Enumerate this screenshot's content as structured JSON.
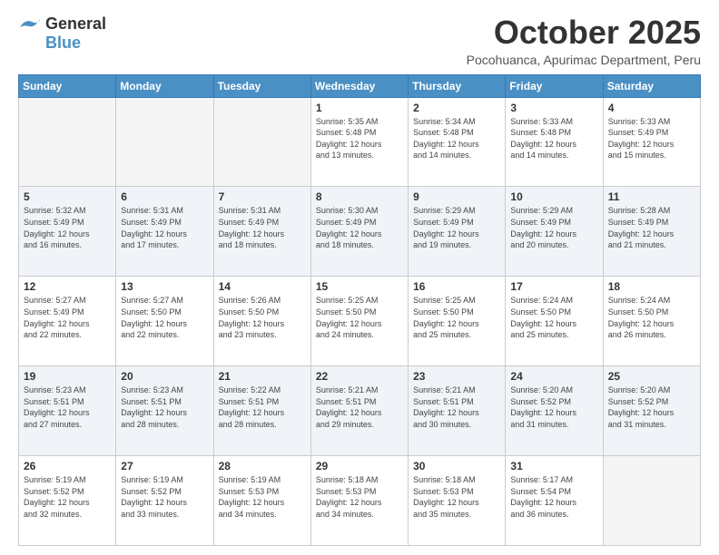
{
  "logo": {
    "line1": "General",
    "line2": "Blue"
  },
  "title": "October 2025",
  "subtitle": "Pocohuanca, Apurimac Department, Peru",
  "days_of_week": [
    "Sunday",
    "Monday",
    "Tuesday",
    "Wednesday",
    "Thursday",
    "Friday",
    "Saturday"
  ],
  "weeks": [
    [
      {
        "day": "",
        "info": ""
      },
      {
        "day": "",
        "info": ""
      },
      {
        "day": "",
        "info": ""
      },
      {
        "day": "1",
        "info": "Sunrise: 5:35 AM\nSunset: 5:48 PM\nDaylight: 12 hours\nand 13 minutes."
      },
      {
        "day": "2",
        "info": "Sunrise: 5:34 AM\nSunset: 5:48 PM\nDaylight: 12 hours\nand 14 minutes."
      },
      {
        "day": "3",
        "info": "Sunrise: 5:33 AM\nSunset: 5:48 PM\nDaylight: 12 hours\nand 14 minutes."
      },
      {
        "day": "4",
        "info": "Sunrise: 5:33 AM\nSunset: 5:49 PM\nDaylight: 12 hours\nand 15 minutes."
      }
    ],
    [
      {
        "day": "5",
        "info": "Sunrise: 5:32 AM\nSunset: 5:49 PM\nDaylight: 12 hours\nand 16 minutes."
      },
      {
        "day": "6",
        "info": "Sunrise: 5:31 AM\nSunset: 5:49 PM\nDaylight: 12 hours\nand 17 minutes."
      },
      {
        "day": "7",
        "info": "Sunrise: 5:31 AM\nSunset: 5:49 PM\nDaylight: 12 hours\nand 18 minutes."
      },
      {
        "day": "8",
        "info": "Sunrise: 5:30 AM\nSunset: 5:49 PM\nDaylight: 12 hours\nand 18 minutes."
      },
      {
        "day": "9",
        "info": "Sunrise: 5:29 AM\nSunset: 5:49 PM\nDaylight: 12 hours\nand 19 minutes."
      },
      {
        "day": "10",
        "info": "Sunrise: 5:29 AM\nSunset: 5:49 PM\nDaylight: 12 hours\nand 20 minutes."
      },
      {
        "day": "11",
        "info": "Sunrise: 5:28 AM\nSunset: 5:49 PM\nDaylight: 12 hours\nand 21 minutes."
      }
    ],
    [
      {
        "day": "12",
        "info": "Sunrise: 5:27 AM\nSunset: 5:49 PM\nDaylight: 12 hours\nand 22 minutes."
      },
      {
        "day": "13",
        "info": "Sunrise: 5:27 AM\nSunset: 5:50 PM\nDaylight: 12 hours\nand 22 minutes."
      },
      {
        "day": "14",
        "info": "Sunrise: 5:26 AM\nSunset: 5:50 PM\nDaylight: 12 hours\nand 23 minutes."
      },
      {
        "day": "15",
        "info": "Sunrise: 5:25 AM\nSunset: 5:50 PM\nDaylight: 12 hours\nand 24 minutes."
      },
      {
        "day": "16",
        "info": "Sunrise: 5:25 AM\nSunset: 5:50 PM\nDaylight: 12 hours\nand 25 minutes."
      },
      {
        "day": "17",
        "info": "Sunrise: 5:24 AM\nSunset: 5:50 PM\nDaylight: 12 hours\nand 25 minutes."
      },
      {
        "day": "18",
        "info": "Sunrise: 5:24 AM\nSunset: 5:50 PM\nDaylight: 12 hours\nand 26 minutes."
      }
    ],
    [
      {
        "day": "19",
        "info": "Sunrise: 5:23 AM\nSunset: 5:51 PM\nDaylight: 12 hours\nand 27 minutes."
      },
      {
        "day": "20",
        "info": "Sunrise: 5:23 AM\nSunset: 5:51 PM\nDaylight: 12 hours\nand 28 minutes."
      },
      {
        "day": "21",
        "info": "Sunrise: 5:22 AM\nSunset: 5:51 PM\nDaylight: 12 hours\nand 28 minutes."
      },
      {
        "day": "22",
        "info": "Sunrise: 5:21 AM\nSunset: 5:51 PM\nDaylight: 12 hours\nand 29 minutes."
      },
      {
        "day": "23",
        "info": "Sunrise: 5:21 AM\nSunset: 5:51 PM\nDaylight: 12 hours\nand 30 minutes."
      },
      {
        "day": "24",
        "info": "Sunrise: 5:20 AM\nSunset: 5:52 PM\nDaylight: 12 hours\nand 31 minutes."
      },
      {
        "day": "25",
        "info": "Sunrise: 5:20 AM\nSunset: 5:52 PM\nDaylight: 12 hours\nand 31 minutes."
      }
    ],
    [
      {
        "day": "26",
        "info": "Sunrise: 5:19 AM\nSunset: 5:52 PM\nDaylight: 12 hours\nand 32 minutes."
      },
      {
        "day": "27",
        "info": "Sunrise: 5:19 AM\nSunset: 5:52 PM\nDaylight: 12 hours\nand 33 minutes."
      },
      {
        "day": "28",
        "info": "Sunrise: 5:19 AM\nSunset: 5:53 PM\nDaylight: 12 hours\nand 34 minutes."
      },
      {
        "day": "29",
        "info": "Sunrise: 5:18 AM\nSunset: 5:53 PM\nDaylight: 12 hours\nand 34 minutes."
      },
      {
        "day": "30",
        "info": "Sunrise: 5:18 AM\nSunset: 5:53 PM\nDaylight: 12 hours\nand 35 minutes."
      },
      {
        "day": "31",
        "info": "Sunrise: 5:17 AM\nSunset: 5:54 PM\nDaylight: 12 hours\nand 36 minutes."
      },
      {
        "day": "",
        "info": ""
      }
    ]
  ]
}
